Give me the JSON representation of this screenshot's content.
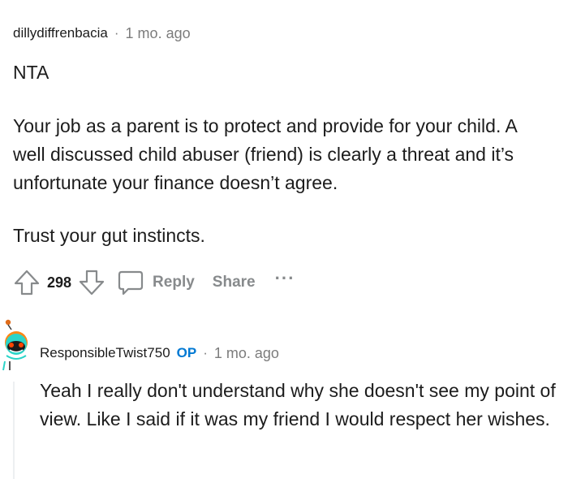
{
  "comment": {
    "username": "dillydiffrenbacia",
    "separator": "·",
    "time": "1 mo. ago",
    "paragraphs": [
      "NTA",
      "Your job as a parent is to protect and provide for your child. A well discussed child abuser (friend) is clearly a threat and it’s unfortunate your finance doesn’t agree.",
      "Trust your gut instincts."
    ],
    "actions": {
      "upvote_icon": "arrow-up-outline-icon",
      "vote_count": "298",
      "downvote_icon": "arrow-down-outline-icon",
      "reply_icon": "speech-bubble-icon",
      "reply_label": "Reply",
      "share_label": "Share",
      "more_label": "···"
    }
  },
  "reply": {
    "avatar_icon": "snoo-avatar-icon",
    "username": "ResponsibleTwist750",
    "op_badge": "OP",
    "separator": "·",
    "time": "1 mo. ago",
    "text": "Yeah I really don't understand why she doesn't see my point of view. Like I said if it was my friend I would respect her wishes."
  },
  "colors": {
    "text": "#1c1c1c",
    "muted": "#878a8c",
    "op_blue": "#0079d3",
    "thread_line": "#edeff1"
  }
}
